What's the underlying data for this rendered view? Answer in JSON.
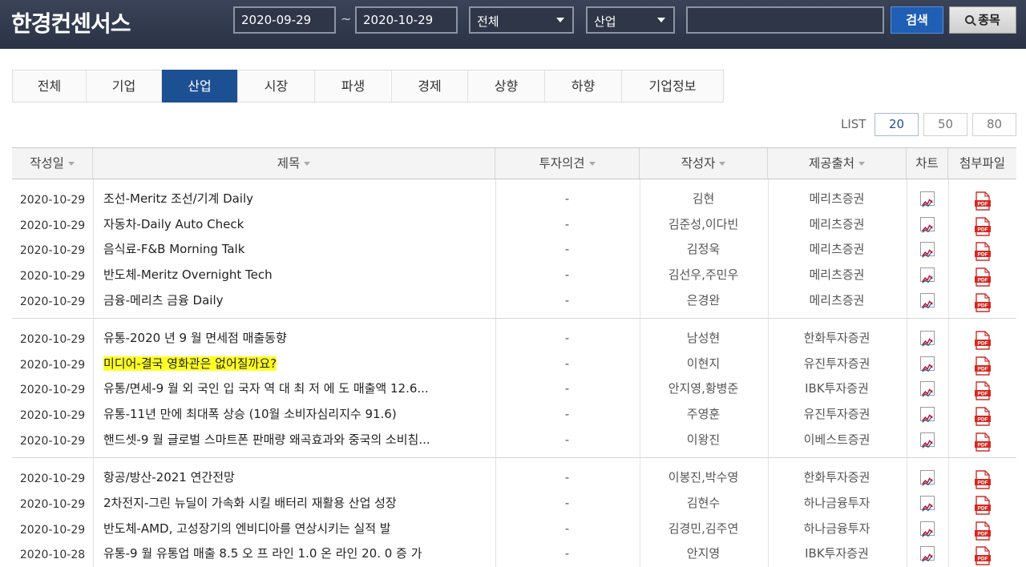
{
  "header": {
    "logo": "한경컨센서스",
    "date_from": "2020-09-29",
    "date_sep": "~",
    "date_to": "2020-10-29",
    "category_select": "전체",
    "type_select": "산업",
    "search_value": "",
    "search_button": "검색",
    "stock_button": "종목"
  },
  "tabs": [
    {
      "label": "전체",
      "active": false
    },
    {
      "label": "기업",
      "active": false
    },
    {
      "label": "산업",
      "active": true
    },
    {
      "label": "시장",
      "active": false
    },
    {
      "label": "파생",
      "active": false
    },
    {
      "label": "경제",
      "active": false
    },
    {
      "label": "상향",
      "active": false
    },
    {
      "label": "하향",
      "active": false
    },
    {
      "label": "기업정보",
      "active": false
    }
  ],
  "list_size": {
    "label": "LIST",
    "options": [
      "20",
      "50",
      "80"
    ],
    "selected": "20"
  },
  "table": {
    "columns": [
      "작성일",
      "제목",
      "투자의견",
      "작성자",
      "제공출처",
      "차트",
      "첨부파일"
    ],
    "rows": [
      {
        "date": "2020-10-29",
        "title": "조선-Meritz 조선/기계 Daily",
        "opinion": "-",
        "author": "김현",
        "source": "메리츠증권",
        "highlight": false
      },
      {
        "date": "2020-10-29",
        "title": "자동차-Daily Auto Check",
        "opinion": "-",
        "author": "김준성,이다빈",
        "source": "메리츠증권",
        "highlight": false
      },
      {
        "date": "2020-10-29",
        "title": "음식료-F&B Morning Talk",
        "opinion": "-",
        "author": "김정욱",
        "source": "메리츠증권",
        "highlight": false
      },
      {
        "date": "2020-10-29",
        "title": "반도체-Meritz Overnight Tech",
        "opinion": "-",
        "author": "김선우,주민우",
        "source": "메리츠증권",
        "highlight": false
      },
      {
        "date": "2020-10-29",
        "title": "금융-메리츠 금융 Daily",
        "opinion": "-",
        "author": "은경완",
        "source": "메리츠증권",
        "highlight": false
      },
      {
        "date": "2020-10-29",
        "title": "유통-2020 년 9 월 면세점 매출동향",
        "opinion": "-",
        "author": "남성현",
        "source": "한화투자증권",
        "highlight": false
      },
      {
        "date": "2020-10-29",
        "title": "미디어-결국 영화관은 없어질까요?",
        "opinion": "-",
        "author": "이현지",
        "source": "유진투자증권",
        "highlight": true
      },
      {
        "date": "2020-10-29",
        "title": "유통/면세-9 월 외 국인 입 국자 역 대 최 저 에 도 매출액 12.6...",
        "opinion": "-",
        "author": "안지영,황병준",
        "source": "IBK투자증권",
        "highlight": false
      },
      {
        "date": "2020-10-29",
        "title": "유통-11년 만에 최대폭 상승 (10월 소비자심리지수 91.6)",
        "opinion": "-",
        "author": "주영훈",
        "source": "유진투자증권",
        "highlight": false
      },
      {
        "date": "2020-10-29",
        "title": "핸드셋-9 월 글로벌 스마트폰 판매량 왜곡효과와 중국의 소비침...",
        "opinion": "-",
        "author": "이왕진",
        "source": "이베스트증권",
        "highlight": false
      },
      {
        "date": "2020-10-29",
        "title": "항공/방산-2021 연간전망",
        "opinion": "-",
        "author": "이봉진,박수영",
        "source": "한화투자증권",
        "highlight": false
      },
      {
        "date": "2020-10-29",
        "title": "2차전지-그린 뉴딜이 가속화 시킬 배터리 재활용 산업 성장",
        "opinion": "-",
        "author": "김현수",
        "source": "하나금융투자",
        "highlight": false
      },
      {
        "date": "2020-10-29",
        "title": "반도체-AMD, 고성장기의 엔비디아를 연상시키는 실적 발",
        "opinion": "-",
        "author": "김경민,김주연",
        "source": "하나금융투자",
        "highlight": false
      },
      {
        "date": "2020-10-28",
        "title": "유통-9 월 유통업 매출 8.5 오 프 라인 1.0 온 라인 20. 0 증 가",
        "opinion": "-",
        "author": "안지영",
        "source": "IBK투자증권",
        "highlight": false
      }
    ]
  },
  "icons": {
    "chart": "chart-icon",
    "attachment": "pdf-icon",
    "pdf_text": "PDF"
  },
  "colors": {
    "header_bg": "#2b3346",
    "active_tab": "#1d4f93",
    "search_button": "#1f5fb5",
    "highlight": "#ffff22"
  }
}
